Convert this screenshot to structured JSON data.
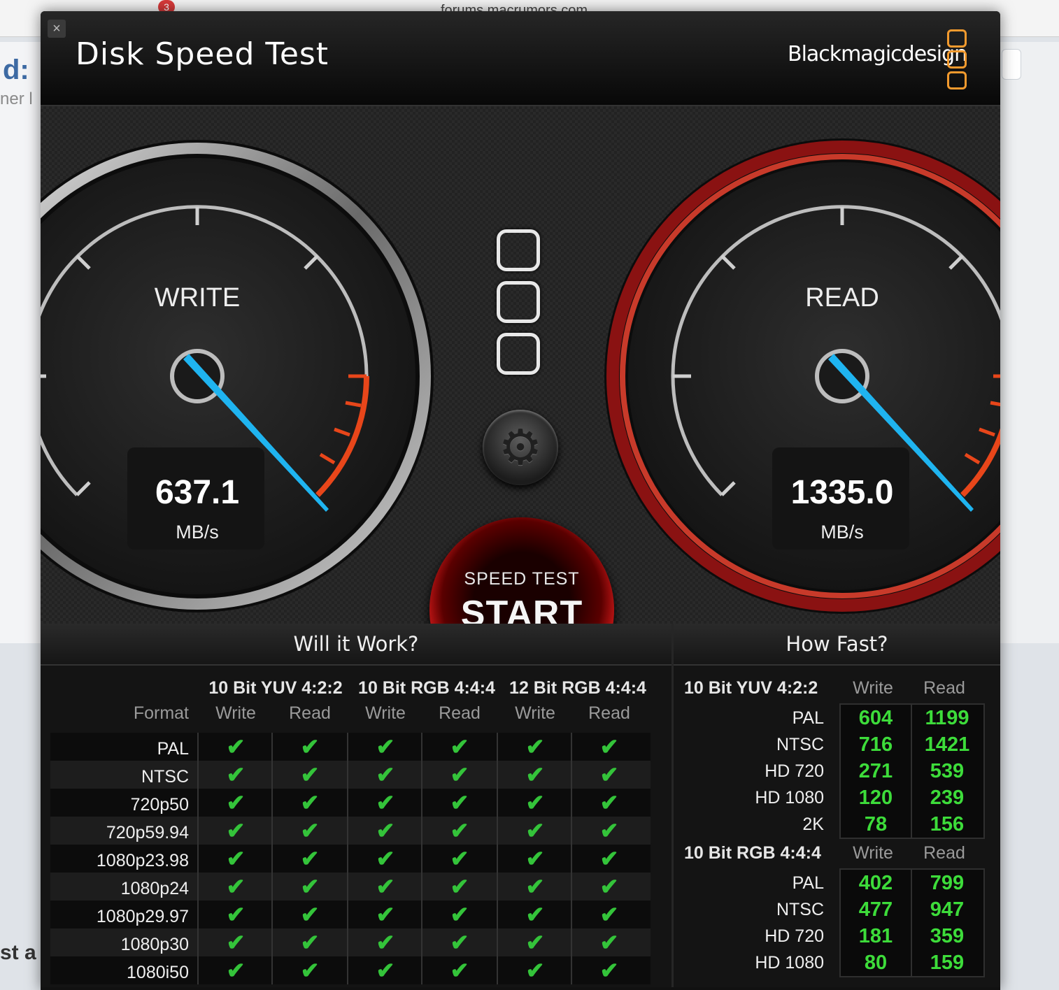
{
  "browser": {
    "url": "forums.macrumors.com",
    "tab_badge": "3"
  },
  "background_page": {
    "title_fragment": "d:",
    "subtitle_fragment": "ner l",
    "bottom_fragment": "st a"
  },
  "app": {
    "title": "Disk Speed Test",
    "brand": "Blackmagicdesign",
    "close_glyph": "×"
  },
  "write_gauge": {
    "label": "WRITE",
    "value": "637.1",
    "unit": "MB/s"
  },
  "read_gauge": {
    "label": "READ",
    "value": "1335.0",
    "unit": "MB/s"
  },
  "start_button": {
    "small": "SPEED TEST",
    "big": "START"
  },
  "gear_icon": "⚙",
  "will_it_work": {
    "title": "Will it Work?",
    "format_header": "Format",
    "groups": [
      "10 Bit YUV 4:2:2",
      "10 Bit RGB 4:4:4",
      "12 Bit RGB 4:4:4"
    ],
    "subheaders": [
      "Write",
      "Read",
      "Write",
      "Read",
      "Write",
      "Read"
    ],
    "check_glyph": "✔",
    "rows": [
      "PAL",
      "NTSC",
      "720p50",
      "720p59.94",
      "1080p23.98",
      "1080p24",
      "1080p29.97",
      "1080p30",
      "1080i50"
    ]
  },
  "how_fast": {
    "title": "How Fast?",
    "sections": [
      {
        "name": "10 Bit YUV 4:2:2",
        "write_header": "Write",
        "read_header": "Read",
        "rows": [
          {
            "label": "PAL",
            "write": "604",
            "read": "1199"
          },
          {
            "label": "NTSC",
            "write": "716",
            "read": "1421"
          },
          {
            "label": "HD 720",
            "write": "271",
            "read": "539"
          },
          {
            "label": "HD 1080",
            "write": "120",
            "read": "239"
          },
          {
            "label": "2K",
            "write": "78",
            "read": "156"
          }
        ]
      },
      {
        "name": "10 Bit RGB 4:4:4",
        "write_header": "Write",
        "read_header": "Read",
        "rows": [
          {
            "label": "PAL",
            "write": "402",
            "read": "799"
          },
          {
            "label": "NTSC",
            "write": "477",
            "read": "947"
          },
          {
            "label": "HD 720",
            "write": "181",
            "read": "359"
          },
          {
            "label": "HD 1080",
            "write": "80",
            "read": "159"
          }
        ]
      }
    ]
  },
  "colors": {
    "accent_red": "#c41616",
    "needle_blue": "#1fb4f0",
    "pass_green": "#34c43a",
    "value_green": "#3ddc3a",
    "logo_orange": "#f29a2e"
  }
}
